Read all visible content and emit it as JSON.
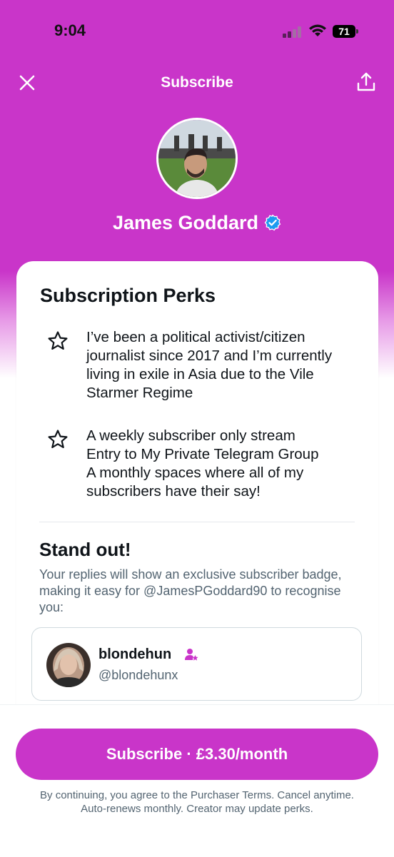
{
  "status_bar": {
    "time": "9:04",
    "battery": "71"
  },
  "nav": {
    "title": "Subscribe"
  },
  "creator": {
    "name": "James Goddard"
  },
  "perks": {
    "title": "Subscription Perks",
    "items": [
      {
        "text": "I’ve been a political activist/citizen journalist since 2017 and I’m currently living in exile in Asia due to the Vile Starmer Regime"
      },
      {
        "text": "A weekly subscriber only stream\nEntry to My Private Telegram Group\nA monthly spaces where all of my subscribers have their say!"
      }
    ]
  },
  "stand_out": {
    "title": "Stand out!",
    "description": "Your replies will show an exclusive subscriber badge, making it easy for @JamesPGoddard90 to recognise you:",
    "preview": {
      "name": "blondehun",
      "handle": "@blondehunx"
    }
  },
  "footer": {
    "button_label": "Subscribe · £3.30/month",
    "legal": "By continuing, you agree to the Purchaser Terms. Cancel anytime. Auto-renews monthly. Creator may update perks."
  },
  "colors": {
    "accent": "#c935c9",
    "verified": "#1d9bf0",
    "text": "#0f1419",
    "muted": "#536471"
  },
  "icons": [
    "close-icon",
    "share-icon",
    "verified-badge-icon",
    "star-icon",
    "subscriber-badge-icon",
    "wifi-icon",
    "signal-icon",
    "battery-icon"
  ]
}
